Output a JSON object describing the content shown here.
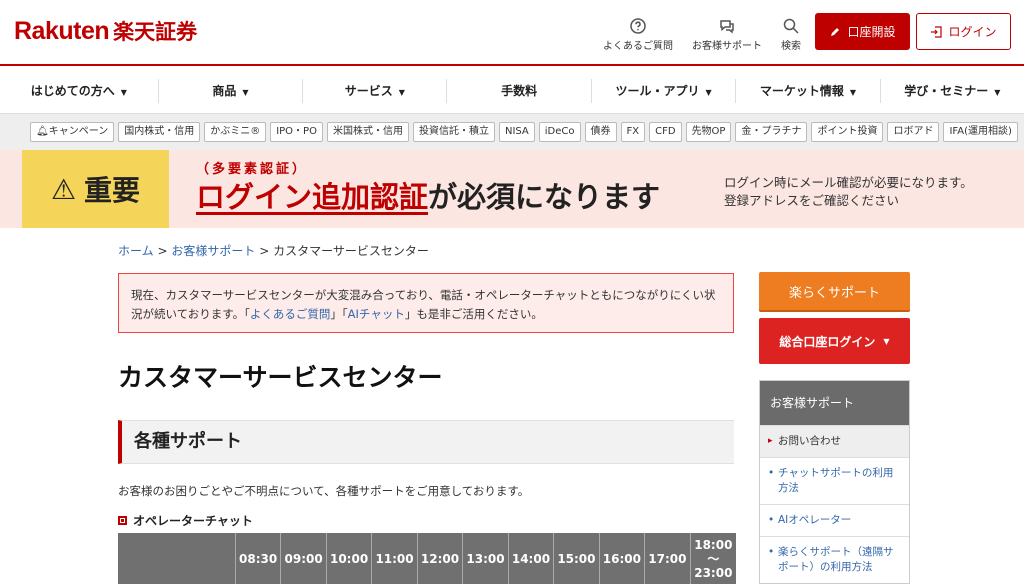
{
  "header": {
    "logo_en": "Rakuten",
    "logo_jp": "楽天証券",
    "faq_label": "よくあるご質問",
    "support_label": "お客様サポート",
    "search_label": "検索",
    "open_account_label": "口座開設",
    "login_label": "ログイン",
    "accent": "#bf0000"
  },
  "gnav": {
    "items": [
      "はじめての方へ",
      "商品",
      "サービス",
      "手数料",
      "ツール・アプリ",
      "マーケット情報",
      "学び・セミナー"
    ]
  },
  "subnav": {
    "items": [
      "キャンペーン",
      "国内株式・信用",
      "かぶミニ®",
      "IPO・PO",
      "米国株式・信用",
      "投資信託・積立",
      "NISA",
      "iDeCo",
      "債券",
      "FX",
      "CFD",
      "先物OP",
      "金・プラチナ",
      "ポイント投資",
      "ロボアド",
      "IFA(運用相談)"
    ]
  },
  "banner": {
    "important": "重要",
    "sub": "（多要素認証）",
    "main_red": "ログイン追加認証",
    "main_rest": "が必須になります",
    "note_line1": "ログイン時にメール確認が必要になります。",
    "note_line2": "登録アドレスをご確認ください"
  },
  "breadcrumb": {
    "home": "ホーム",
    "support": "お客様サポート",
    "current": "カスタマーサービスセンター",
    "sep": ">"
  },
  "notice": {
    "text1": "現在、カスタマーサービスセンターが大変混み合っており、電話・オペレーターチャットともにつながりにくい状況が続いております。「",
    "link1": "よくあるご質問",
    "text2": "」「",
    "link2": "AIチャット",
    "text3": "」も是非ご活用ください。"
  },
  "main": {
    "title": "カスタマーサービスセンター",
    "section_title": "各種サポート",
    "description": "お客様のお困りごとやご不明点について、各種サポートをご用意しております。",
    "operator_chat_title": "オペレーターチャット"
  },
  "hours_table": {
    "headers": [
      "08:30",
      "09:00",
      "10:00",
      "11:00",
      "12:00",
      "13:00",
      "14:00",
      "15:00",
      "16:00",
      "17:00"
    ],
    "last_header_top": "18:00",
    "last_header_mid": "〜",
    "last_header_bottom": "23:00"
  },
  "sidebar": {
    "easy_support": "楽らくサポート",
    "account_login": "総合口座ログイン",
    "box_title": "お客様サポート",
    "items": [
      "お問い合わせ",
      "チャットサポートの利用方法",
      "AIオペレーター",
      "楽らくサポート（遠隔サポート）の利用方法"
    ]
  }
}
